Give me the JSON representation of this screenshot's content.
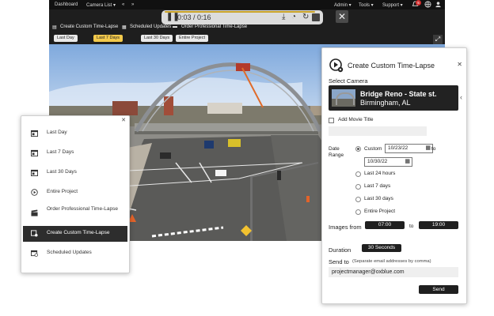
{
  "topnav": {
    "dashboard": "Dashboard",
    "camera_list": "Camera List ▾",
    "prev": "«",
    "next": "»",
    "admin": "Admin ▾",
    "tools": "Tools ▾",
    "support": "Support ▾",
    "notif_count": "5"
  },
  "player": {
    "time": "0:03 / 0:16"
  },
  "subbar": {
    "create": "Create Custom Time-Lapse",
    "scheduled": "Scheduled Updates",
    "order": "Order Professional Time-Lapse"
  },
  "rangebar": {
    "buttons": [
      "Last Day",
      "Last 7 Days",
      "Last 30 Days",
      "Entire Project"
    ],
    "active_index": 1
  },
  "menu": {
    "items": [
      {
        "label": "Last Day",
        "icon": "calendar-icon"
      },
      {
        "label": "Last 7 Days",
        "icon": "calendar-icon"
      },
      {
        "label": "Last 30 Days",
        "icon": "calendar-icon"
      },
      {
        "label": "Entire Project",
        "icon": "play-circle-icon"
      },
      {
        "label": "Order Professional Time-Lapse",
        "icon": "clapperboard-icon"
      },
      {
        "label": "Create Custom Time-Lapse",
        "icon": "film-gear-icon"
      },
      {
        "label": "Scheduled Updates",
        "icon": "schedule-icon"
      }
    ],
    "active_index": 5
  },
  "form": {
    "title": "Create Custom Time-Lapse",
    "select_camera": "Select Camera",
    "camera_name": "Bridge Reno - State st.",
    "camera_location": "Birmingham, AL",
    "add_movie_title": "Add Movie Title",
    "date_range": "Date Range",
    "custom": "Custom",
    "date_from": "10/23/22",
    "to": "to",
    "date_to": "10/30/22",
    "ranges": [
      "Last 24 hours",
      "Last 7 days",
      "Last 30 days",
      "Entire Project"
    ],
    "images_from": "Images from",
    "time_from": "07:00",
    "time_to": "19:00",
    "duration": "Duration",
    "duration_value": "30 Seconds",
    "send_to": "Send to",
    "send_note": "(Separate email addresses by comma)",
    "email": "projectmanager@oxblue.com",
    "send_button": "Send"
  },
  "colors": {
    "accent": "#f2c94c",
    "dark": "#1f1f1f"
  }
}
